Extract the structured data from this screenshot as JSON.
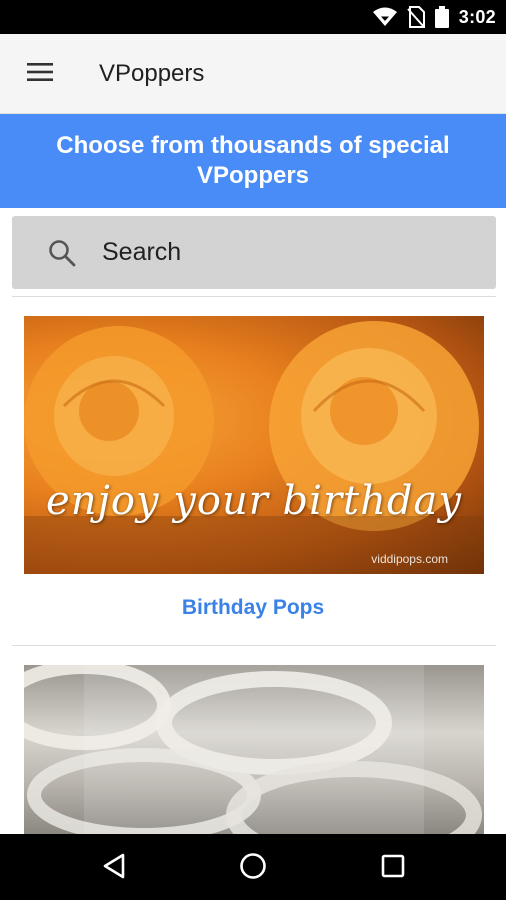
{
  "status_bar": {
    "time": "3:02",
    "icons": [
      "wifi-icon",
      "no-sim-icon",
      "battery-icon"
    ]
  },
  "app_bar": {
    "menu_icon": "menu-icon",
    "title": "VPoppers"
  },
  "banner": {
    "text": "Choose from thousands of special VPoppers",
    "background": "#4a8cf7"
  },
  "search": {
    "placeholder": "Search",
    "icon": "search-icon"
  },
  "cards": [
    {
      "image_caption": "enjoy your birthday",
      "image_watermark": "viddipops.com",
      "title": "Birthday Pops"
    },
    {
      "image_caption": "",
      "title": ""
    }
  ],
  "colors": {
    "accent": "#3b82e8",
    "banner": "#4a8cf7",
    "search_bg": "#d3d3d3"
  },
  "nav_bar": {
    "icons": [
      "back-icon",
      "home-icon",
      "recents-icon"
    ]
  }
}
